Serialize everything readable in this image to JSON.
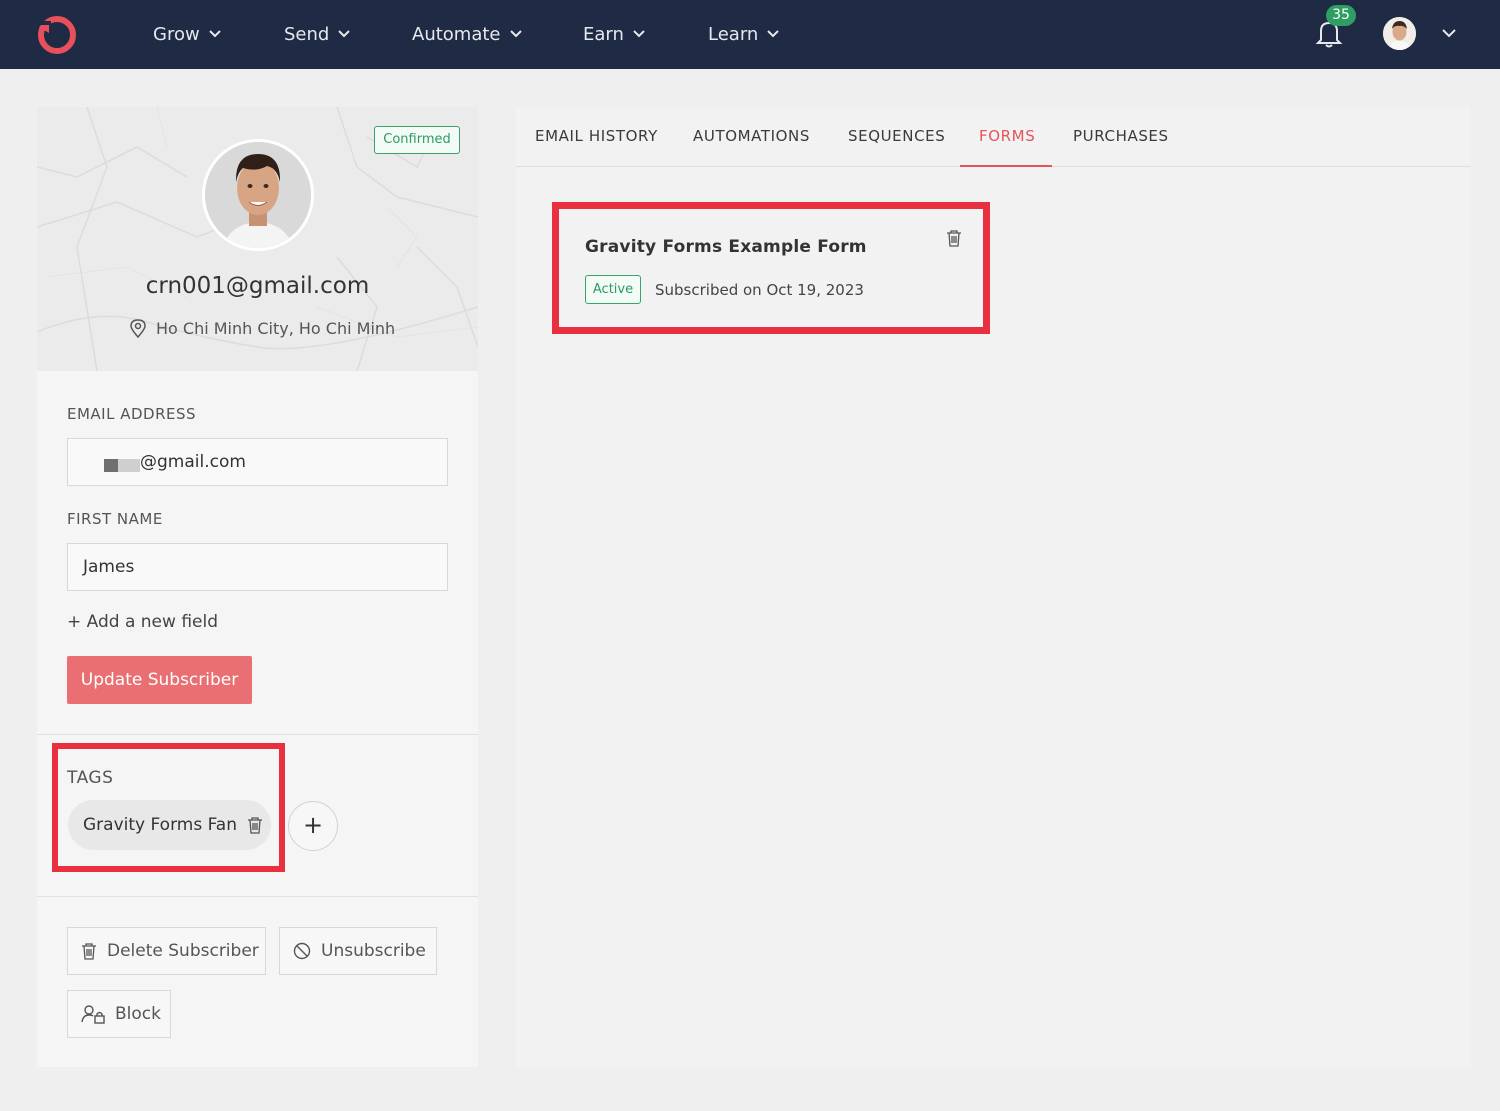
{
  "nav": {
    "items": [
      {
        "label": "Grow"
      },
      {
        "label": "Send"
      },
      {
        "label": "Automate"
      },
      {
        "label": "Earn"
      },
      {
        "label": "Learn"
      }
    ],
    "notification_count": "35",
    "brand_color": "#e8505b",
    "bg_color": "#1f2a44"
  },
  "profile": {
    "status_badge": "Confirmed",
    "email": "crn001@gmail.com",
    "location": "Ho Chi Minh City, Ho Chi Minh"
  },
  "fields": {
    "email_label": "EMAIL ADDRESS",
    "email_value": "@gmail.com",
    "first_name_label": "FIRST NAME",
    "first_name_value": "James",
    "add_field_label": "+ Add a new field",
    "update_button": "Update Subscriber"
  },
  "tags": {
    "heading": "TAGS",
    "items": [
      {
        "label": "Gravity Forms Fan"
      }
    ],
    "add_label": "+"
  },
  "actions": {
    "delete": "Delete Subscriber",
    "unsubscribe": "Unsubscribe",
    "block": "Block"
  },
  "tabs": [
    {
      "label": "EMAIL HISTORY",
      "active": false
    },
    {
      "label": "AUTOMATIONS",
      "active": false
    },
    {
      "label": "SEQUENCES",
      "active": false
    },
    {
      "label": "FORMS",
      "active": true
    },
    {
      "label": "PURCHASES",
      "active": false
    }
  ],
  "forms": [
    {
      "title": "Gravity Forms Example Form",
      "status": "Active",
      "subscribed": "Subscribed on Oct 19, 2023"
    }
  ],
  "colors": {
    "accent": "#e5535b",
    "success": "#2f9a62",
    "highlight": "#e8303f"
  }
}
